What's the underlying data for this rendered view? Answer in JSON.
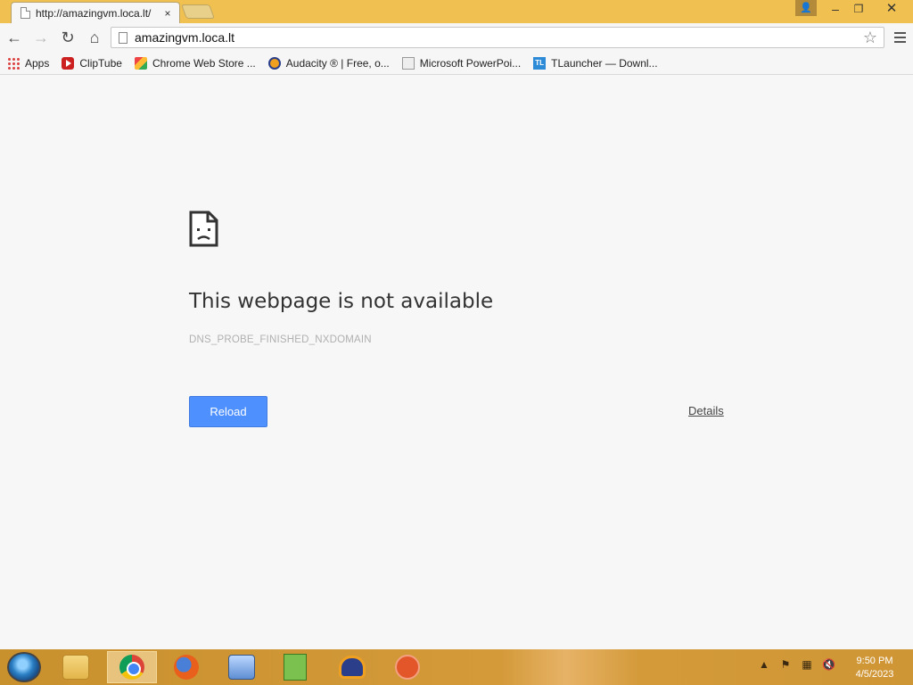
{
  "tab": {
    "title": "http://amazingvm.loca.lt/",
    "close": "×"
  },
  "window": {
    "minimize": "–",
    "maximize": "❐",
    "close": "✕",
    "user_glyph": "👤"
  },
  "toolbar": {
    "back": "←",
    "forward": "→",
    "reload": "↻",
    "home": "⌂",
    "star": "☆"
  },
  "omnibox": {
    "value": "amazingvm.loca.lt"
  },
  "bookmarks": [
    {
      "label": "Apps",
      "icon": "apps-grid-icon"
    },
    {
      "label": "ClipTube",
      "icon": "cliptube-icon"
    },
    {
      "label": "Chrome Web Store ...",
      "icon": "chrome-web-store-icon"
    },
    {
      "label": "Audacity ® | Free, o...",
      "icon": "audacity-icon"
    },
    {
      "label": "Microsoft PowerPoi...",
      "icon": "powerpoint-icon"
    },
    {
      "label": "TLauncher — Downl...",
      "icon": "tlauncher-icon",
      "icon_text": "TL"
    }
  ],
  "error": {
    "title": "This webpage is not available",
    "code": "DNS_PROBE_FINISHED_NXDOMAIN",
    "reload_label": "Reload",
    "details_label": "Details"
  },
  "taskbar": {
    "apps": [
      "start-orb",
      "file-explorer",
      "chrome",
      "firefox",
      "virtual-machine",
      "notepad-plus",
      "audacity",
      "app"
    ],
    "active": "chrome",
    "tray": {
      "arrow": "▲",
      "flag": "⚑",
      "network": "▦",
      "volume": "🔇"
    },
    "clock_time": "9:50 PM",
    "clock_date": "4/5/2023"
  },
  "colors": {
    "titlebar": "#f0c050",
    "reload_button": "#4d90fe",
    "taskbar": "#d49a3a"
  }
}
